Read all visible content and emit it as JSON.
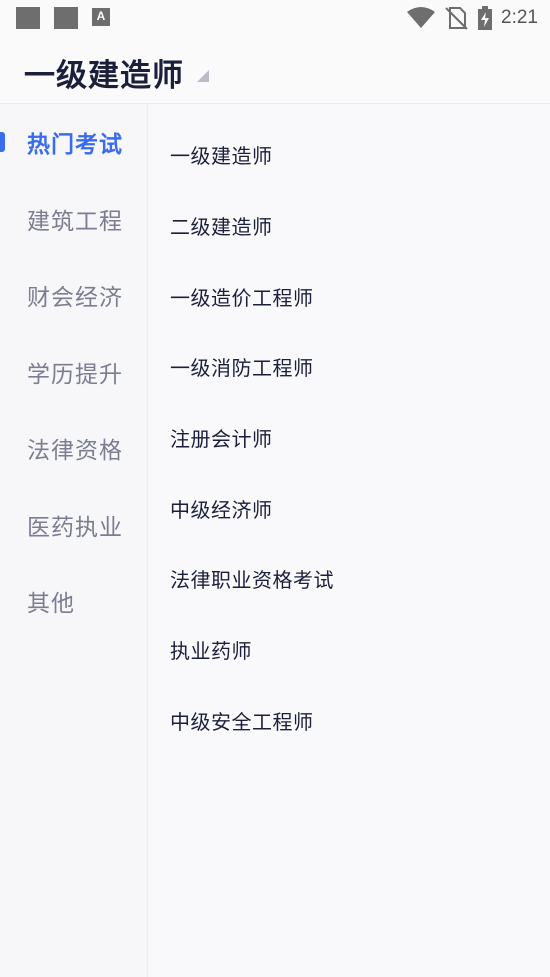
{
  "status_bar": {
    "time": "2:21",
    "left_icons": [
      "notification-square-icon",
      "notification-square-icon",
      "font-a-icon"
    ],
    "right_icons": [
      "wifi-icon",
      "no-sim-icon",
      "battery-charging-icon"
    ],
    "a_label": "A"
  },
  "header": {
    "title": "一级建造师"
  },
  "sidebar": {
    "items": [
      {
        "label": "热门考试",
        "active": true
      },
      {
        "label": "建筑工程",
        "active": false
      },
      {
        "label": "财会经济",
        "active": false
      },
      {
        "label": "学历提升",
        "active": false
      },
      {
        "label": "法律资格",
        "active": false
      },
      {
        "label": "医药执业",
        "active": false
      },
      {
        "label": "其他",
        "active": false
      }
    ]
  },
  "list": {
    "items": [
      "一级建造师",
      "二级建造师",
      "一级造价工程师",
      "一级消防工程师",
      "注册会计师",
      "中级经济师",
      "法律职业资格考试",
      "执业药师",
      "中级安全工程师"
    ]
  },
  "colors": {
    "accent": "#3a6cf0",
    "title": "#1c1f3b",
    "muted": "#7b7e92"
  }
}
